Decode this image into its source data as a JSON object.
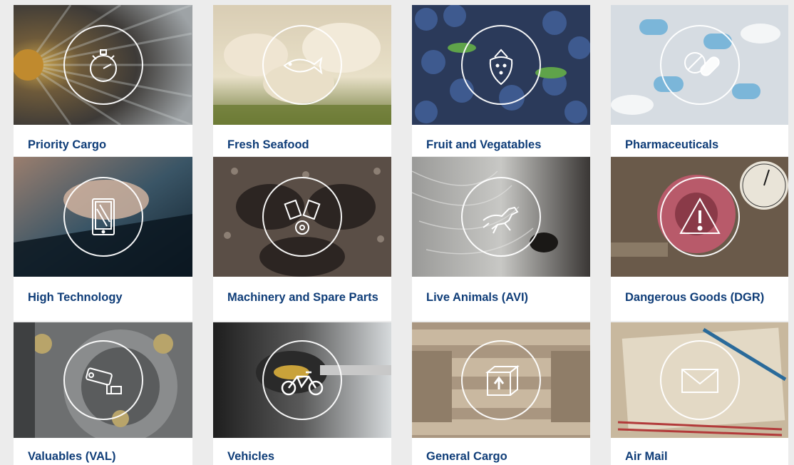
{
  "cards": [
    {
      "title": "Priority Cargo",
      "icon": "stopwatch-icon"
    },
    {
      "title": "Fresh Seafood",
      "icon": "fish-icon"
    },
    {
      "title": "Fruit and Vegatables",
      "icon": "strawberry-icon"
    },
    {
      "title": "Pharmaceuticals",
      "icon": "pills-icon"
    },
    {
      "title": "High Technology",
      "icon": "tablet-icon"
    },
    {
      "title": "Machinery and Spare Parts",
      "icon": "engine-icon"
    },
    {
      "title": "Live Animals (AVI)",
      "icon": "horse-icon"
    },
    {
      "title": "Dangerous Goods (DGR)",
      "icon": "warning-icon"
    },
    {
      "title": "Valuables (VAL)",
      "icon": "security-camera-icon"
    },
    {
      "title": "Vehicles",
      "icon": "motorcycle-icon"
    },
    {
      "title": "General Cargo",
      "icon": "package-icon"
    },
    {
      "title": "Air Mail",
      "icon": "envelope-icon"
    }
  ],
  "colors": {
    "label": "#0f3d78",
    "card_background": "#ffffff",
    "page_background": "#ececec",
    "icon_ring": "#ffffff"
  }
}
